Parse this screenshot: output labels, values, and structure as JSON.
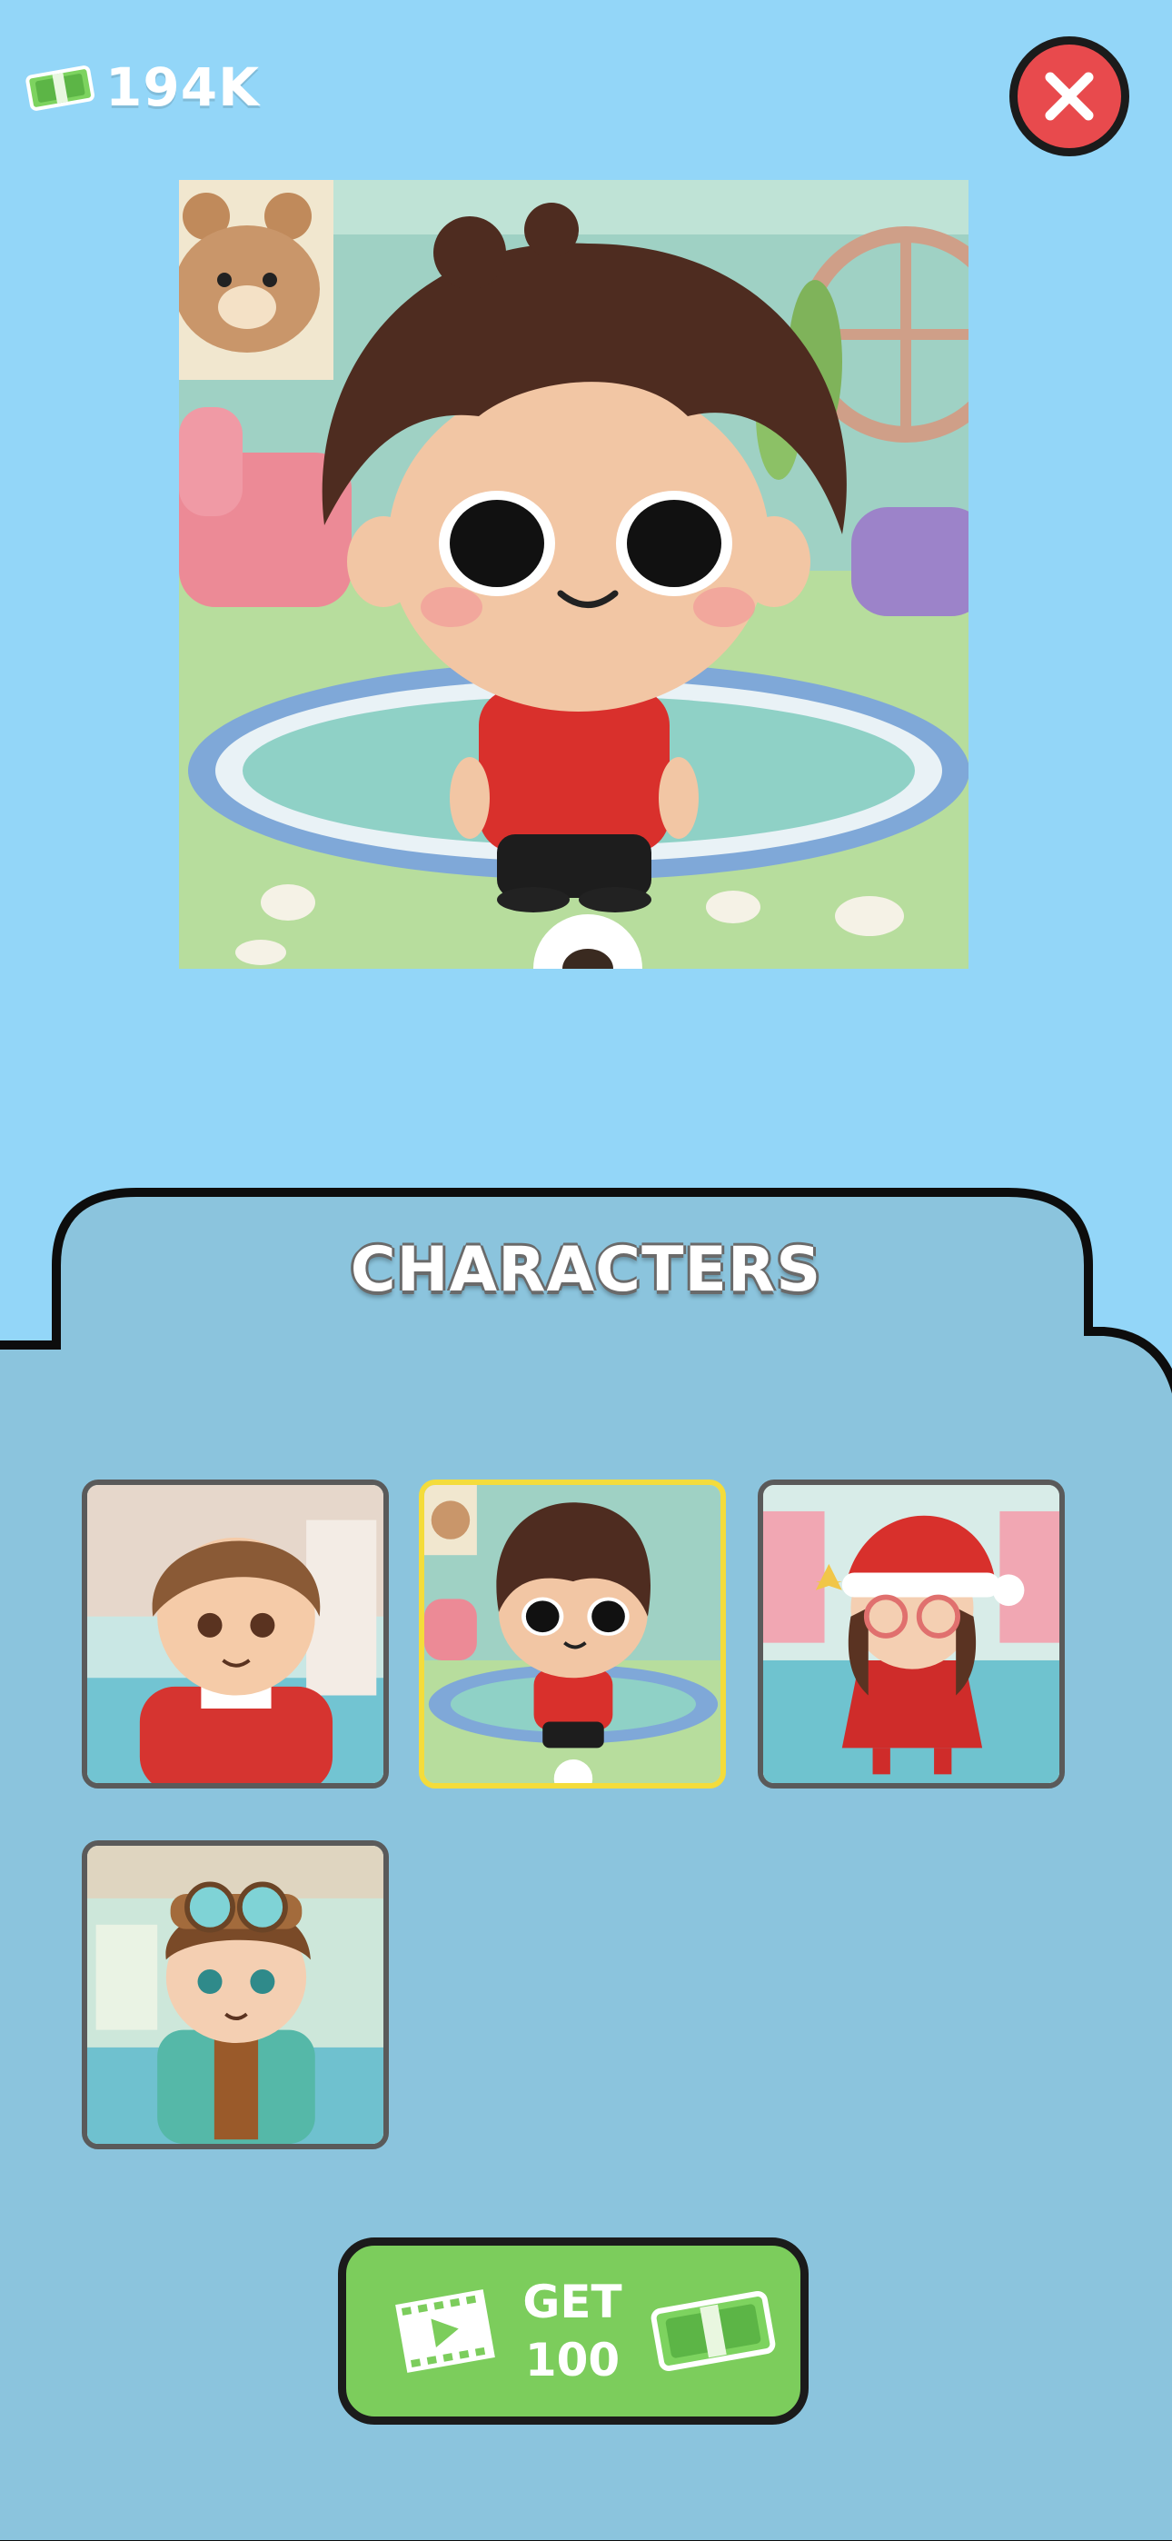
{
  "header": {
    "currency_icon": "cash-bill-icon",
    "currency_amount": "194K",
    "close_icon": "close-x-icon"
  },
  "preview": {
    "character": "curly-hair-boy-red-shirt"
  },
  "panel": {
    "title": "CHARACTERS",
    "characters": [
      {
        "name": "boy-red-sweater",
        "selected": false
      },
      {
        "name": "curly-hair-boy-red-shirt",
        "selected": true
      },
      {
        "name": "girl-santa-hat-red-dress",
        "selected": false
      },
      {
        "name": "aviator-boy-teal-coat",
        "selected": false
      }
    ]
  },
  "reward_button": {
    "icon_left": "video-film-icon",
    "line1": "GET",
    "line2": "100",
    "icon_right": "cash-bill-icon"
  },
  "colors": {
    "background": "#93d6f8",
    "panel": "#8bc4dd",
    "close_button": "#e84a4d",
    "get_button": "#7ccd5c",
    "selected_border": "#f4dc3b"
  }
}
